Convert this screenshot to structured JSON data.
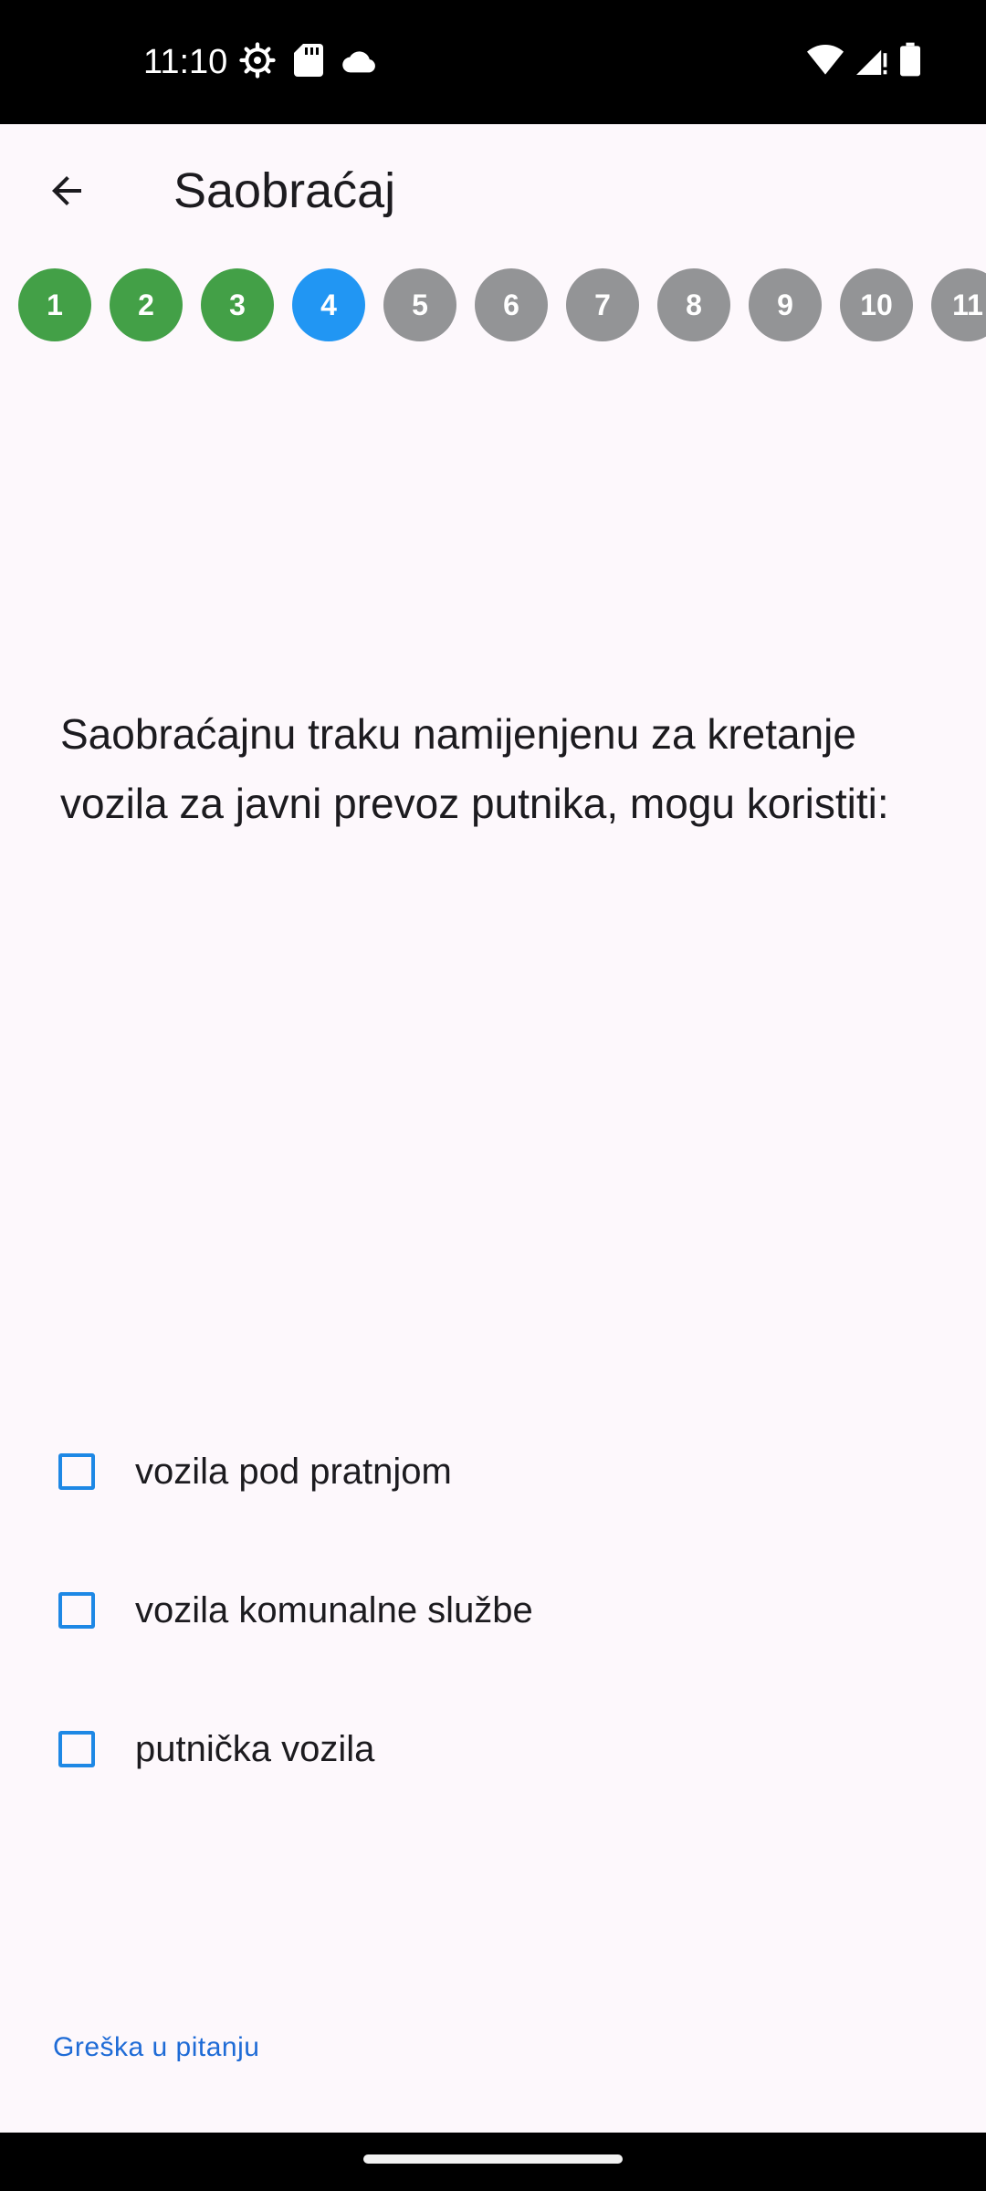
{
  "status_bar": {
    "time": "11:10",
    "left_icons": [
      "settings-gear-icon",
      "sd-card-icon",
      "cloud-icon"
    ],
    "right_icons": [
      "wifi-icon",
      "signal-icon",
      "battery-icon"
    ]
  },
  "app_bar": {
    "back_icon": "arrow-back-icon",
    "title": "Saobraćaj"
  },
  "question_numbers": [
    {
      "label": "1",
      "state": "done"
    },
    {
      "label": "2",
      "state": "done"
    },
    {
      "label": "3",
      "state": "done"
    },
    {
      "label": "4",
      "state": "current"
    },
    {
      "label": "5",
      "state": "todo"
    },
    {
      "label": "6",
      "state": "todo"
    },
    {
      "label": "7",
      "state": "todo"
    },
    {
      "label": "8",
      "state": "todo"
    },
    {
      "label": "9",
      "state": "todo"
    },
    {
      "label": "10",
      "state": "todo"
    },
    {
      "label": "11",
      "state": "todo"
    }
  ],
  "colors": {
    "done": "#43a047",
    "current": "#2196f3",
    "todo": "#939496",
    "checkbox": "#1e88e5",
    "link": "#1e6bd6"
  },
  "question": {
    "text": "Saobraćajnu traku namijenjenu za kretanje vozila za javni prevoz putnika, mogu koristiti:"
  },
  "answers": [
    {
      "label": "vozila pod pratnjom",
      "checked": false
    },
    {
      "label": "vozila komunalne službe",
      "checked": false
    },
    {
      "label": "putnička vozila",
      "checked": false
    }
  ],
  "report_link": "Greška u pitanju"
}
